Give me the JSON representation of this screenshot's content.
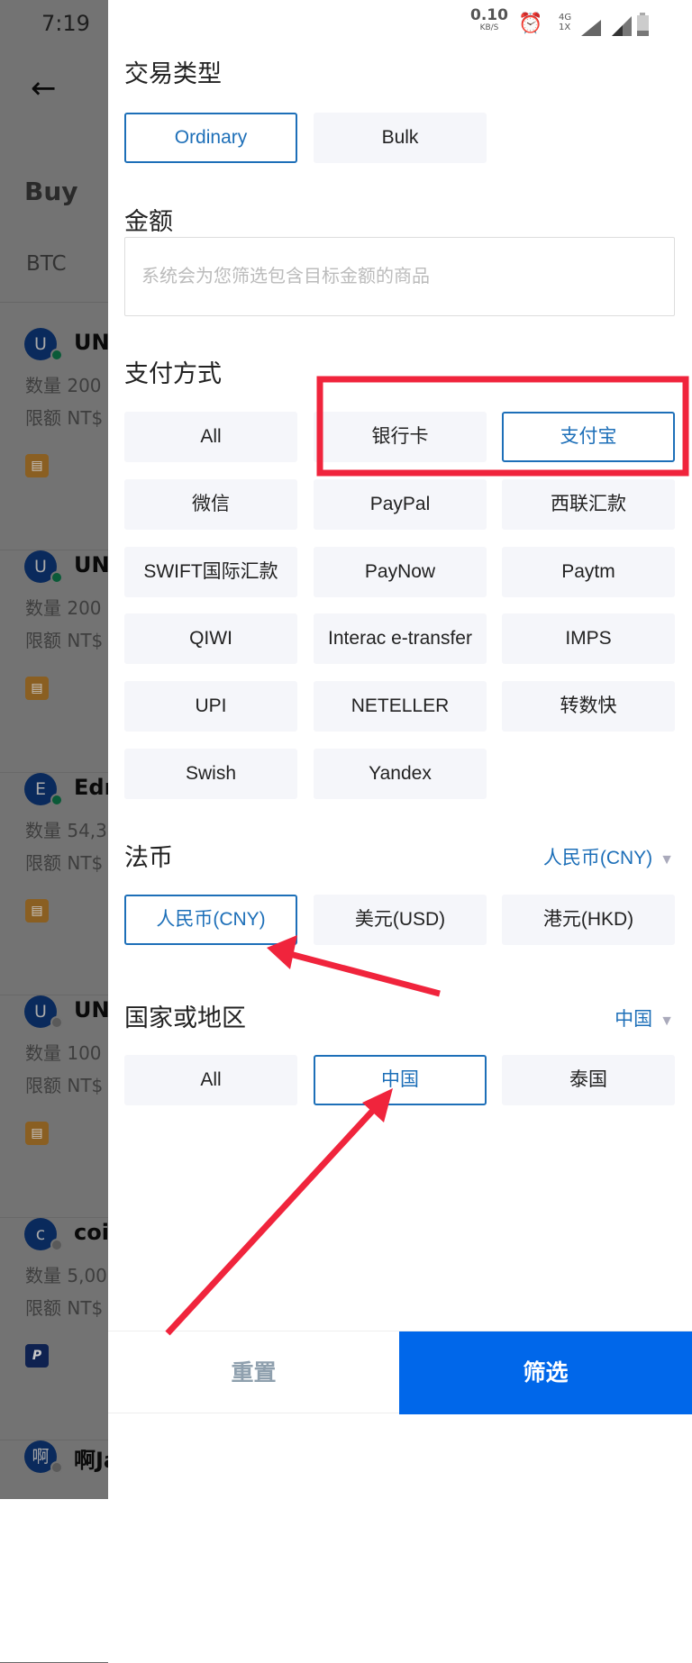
{
  "status_bar": {
    "time": "7:19",
    "net_speed": "0.10",
    "net_unit": "KB/S",
    "network": "4G 1X",
    "icons": [
      "alarm-icon",
      "signal-icon",
      "battery-icon"
    ]
  },
  "background": {
    "back_icon": "arrow-left-icon",
    "tab": "Buy",
    "coin": "BTC",
    "items": [
      {
        "avatar": "U",
        "name": "UN",
        "qty": "数量 200",
        "limit": "限额 NT$",
        "online": true,
        "pay": "bank-card-icon"
      },
      {
        "avatar": "U",
        "name": "UN",
        "qty": "数量 200",
        "limit": "限额 NT$",
        "online": true,
        "pay": "bank-card-icon"
      },
      {
        "avatar": "E",
        "name": "Edr",
        "qty": "数量 54,3",
        "limit": "限额 NT$",
        "online": true,
        "pay": "bank-card-icon"
      },
      {
        "avatar": "U",
        "name": "UN",
        "qty": "数量 100",
        "limit": "限额 NT$",
        "online": false,
        "pay": "bank-card-icon"
      },
      {
        "avatar": "c",
        "name": "coi",
        "qty": "数量 5,00",
        "limit": "限额 NT$",
        "online": false,
        "pay": "paypal-icon"
      },
      {
        "avatar": "啊",
        "name": "啊Ja",
        "qty": "",
        "limit": "",
        "online": false,
        "pay": ""
      }
    ]
  },
  "filter": {
    "trade_type": {
      "title": "交易类型",
      "options": [
        "Ordinary",
        "Bulk"
      ],
      "selected": [
        0
      ]
    },
    "amount": {
      "title": "金额",
      "placeholder": "系统会为您筛选包含目标金额的商品"
    },
    "payment": {
      "title": "支付方式",
      "options": [
        "All",
        "银行卡",
        "支付宝",
        "微信",
        "PayPal",
        "西联汇款",
        "SWIFT国际汇款",
        "PayNow",
        "Paytm",
        "QIWI",
        "Interac e-transfer",
        "IMPS",
        "UPI",
        "NETELLER",
        "转数快",
        "Swish",
        "Yandex"
      ],
      "selected": [
        2
      ]
    },
    "fiat": {
      "title": "法币",
      "current": "人民币(CNY)",
      "options": [
        "人民币(CNY)",
        "美元(USD)",
        "港元(HKD)"
      ],
      "selected": [
        0
      ]
    },
    "region": {
      "title": "国家或地区",
      "current": "中国",
      "options": [
        "All",
        "中国",
        "泰国"
      ],
      "selected": [
        1
      ]
    },
    "reset_label": "重置",
    "apply_label": "筛选"
  },
  "colors": {
    "accent": "#1d6fb8",
    "primary_button": "#0067ea",
    "annotation": "#f0243c"
  }
}
